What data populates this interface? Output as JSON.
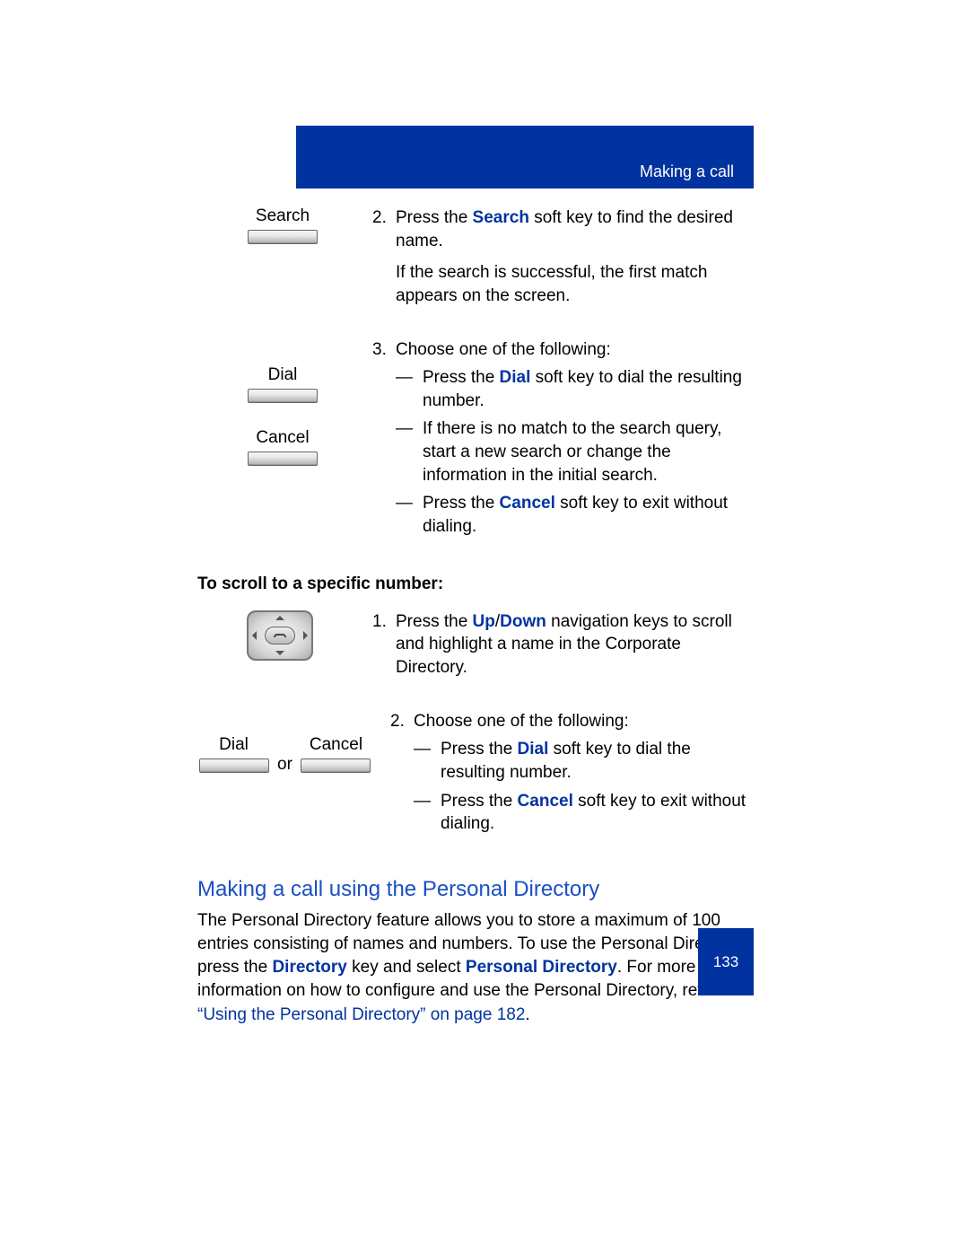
{
  "header": {
    "section": "Making a call"
  },
  "softkeys": {
    "search": "Search",
    "dial": "Dial",
    "cancel": "Cancel",
    "or": "or"
  },
  "steps": {
    "s2": {
      "num": "2.",
      "line1a": "Press the ",
      "line1b": "Search",
      "line1c": " soft key to find the desired name.",
      "line2": "If the search is successful, the first match appears on the screen."
    },
    "s3": {
      "num": "3.",
      "intro": "Choose one of the following:",
      "a1": "Press the ",
      "a2": "Dial",
      "a3": " soft key to dial the resulting number.",
      "b": "If there is no match to the search query, start a new search or change the information in the initial search.",
      "c1": "Press the ",
      "c2": "Cancel",
      "c3": " soft key to exit without dialing."
    }
  },
  "subheading": "To scroll to a specific number:",
  "scroll": {
    "s1": {
      "num": "1.",
      "a": "Press the ",
      "b": "Up",
      "slash": "/",
      "c": "Down",
      "d": " navigation keys to scroll and highlight a name in the Corporate Directory."
    },
    "s2": {
      "num": "2.",
      "intro": "Choose one of the following:",
      "a1": "Press the ",
      "a2": "Dial",
      "a3": " soft key to dial the resulting number.",
      "b1": "Press the ",
      "b2": "Cancel",
      "b3": " soft key to exit without dialing."
    }
  },
  "section": {
    "title": "Making a call using the Personal Directory",
    "p1a": "The Personal Directory feature allows you to store a maximum of 100 entries consisting of names and numbers. To use the Personal Directory, press the ",
    "p1b": "Directory",
    "p1c": " key and select ",
    "p1d": "Personal Directory",
    "p1e": ". For more information on how to configure and use the Personal Directory, refer to ",
    "p1f": "“Using the Personal Directory” on page 182",
    "p1g": "."
  },
  "page_number": "133"
}
